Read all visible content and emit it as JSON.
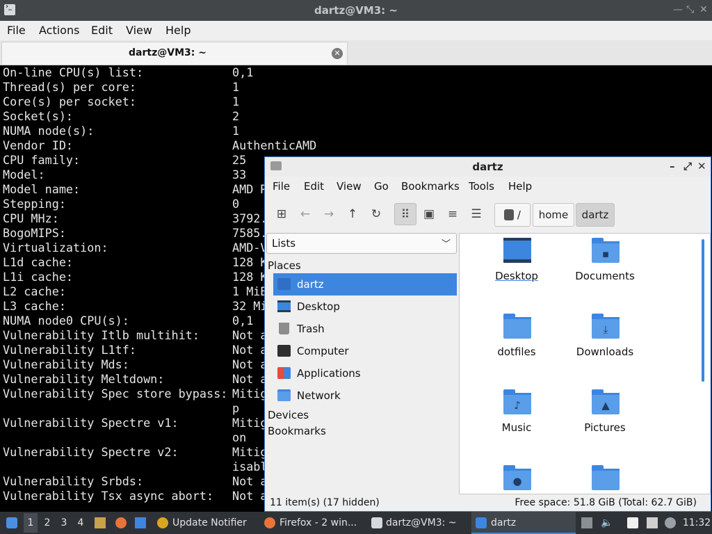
{
  "terminal": {
    "title": "dartz@VM3: ~",
    "menu": [
      "File",
      "Actions",
      "Edit",
      "View",
      "Help"
    ],
    "tab_label": "dartz@VM3: ~",
    "lines": [
      {
        "k": "On-line CPU(s) list:",
        "v": "0,1"
      },
      {
        "k": "Thread(s) per core:",
        "v": "1"
      },
      {
        "k": "Core(s) per socket:",
        "v": "1"
      },
      {
        "k": "Socket(s):",
        "v": "2"
      },
      {
        "k": "NUMA node(s):",
        "v": "1"
      },
      {
        "k": "Vendor ID:",
        "v": "AuthenticAMD"
      },
      {
        "k": "CPU family:",
        "v": "25"
      },
      {
        "k": "Model:",
        "v": "33"
      },
      {
        "k": "Model name:",
        "v": "AMD R"
      },
      {
        "k": "Stepping:",
        "v": "0"
      },
      {
        "k": "CPU MHz:",
        "v": "3792."
      },
      {
        "k": "BogoMIPS:",
        "v": "7585."
      },
      {
        "k": "Virtualization:",
        "v": "AMD-V"
      },
      {
        "k": "L1d cache:",
        "v": "128 K"
      },
      {
        "k": "L1i cache:",
        "v": "128 K"
      },
      {
        "k": "L2 cache:",
        "v": "1 MiB"
      },
      {
        "k": "L3 cache:",
        "v": "32 Mi"
      },
      {
        "k": "NUMA node0 CPU(s):",
        "v": "0,1"
      },
      {
        "k": "Vulnerability Itlb multihit:",
        "v": "Not a"
      },
      {
        "k": "Vulnerability L1tf:",
        "v": "Not a"
      },
      {
        "k": "Vulnerability Mds:",
        "v": "Not a"
      },
      {
        "k": "Vulnerability Meltdown:",
        "v": "Not a"
      },
      {
        "k": "Vulnerability Spec store bypass:",
        "v": "Mitig"
      },
      {
        "k": "",
        "v": "p"
      },
      {
        "k": "Vulnerability Spectre v1:",
        "v": "Mitig"
      },
      {
        "k": "",
        "v": "on"
      },
      {
        "k": "Vulnerability Spectre v2:",
        "v": "Mitig"
      },
      {
        "k": "",
        "v": "isabl"
      },
      {
        "k": "Vulnerability Srbds:",
        "v": "Not a"
      },
      {
        "k": "Vulnerability Tsx async abort:",
        "v": "Not a"
      }
    ]
  },
  "filemanager": {
    "title": "dartz",
    "menu": [
      "File",
      "Edit",
      "View",
      "Go",
      "Bookmarks",
      "Tools",
      "Help"
    ],
    "path": {
      "root": "/",
      "crumbs": [
        "home",
        "dartz"
      ]
    },
    "side_pane_mode": "Lists",
    "sections": {
      "places": "Places",
      "devices": "Devices",
      "bookmarks": "Bookmarks"
    },
    "places": [
      "dartz",
      "Desktop",
      "Trash",
      "Computer",
      "Applications",
      "Network"
    ],
    "items": [
      "Desktop",
      "Documents",
      "dotfiles",
      "Downloads",
      "Music",
      "Pictures",
      "",
      ""
    ],
    "status_left": "11 item(s) (17 hidden)",
    "status_right": "Free space: 51.8 GiB (Total: 62.7 GiB)"
  },
  "taskbar": {
    "workspaces": [
      "1",
      "2",
      "3",
      "4"
    ],
    "tasks": [
      "Update Notifier",
      "Firefox - 2 win...",
      "dartz@VM3: ~",
      "dartz"
    ],
    "clock": "11:32"
  },
  "colors": {
    "accent": "#3d86e0",
    "terminal_bg": "#000000",
    "panel_bg": "#2e3236"
  }
}
